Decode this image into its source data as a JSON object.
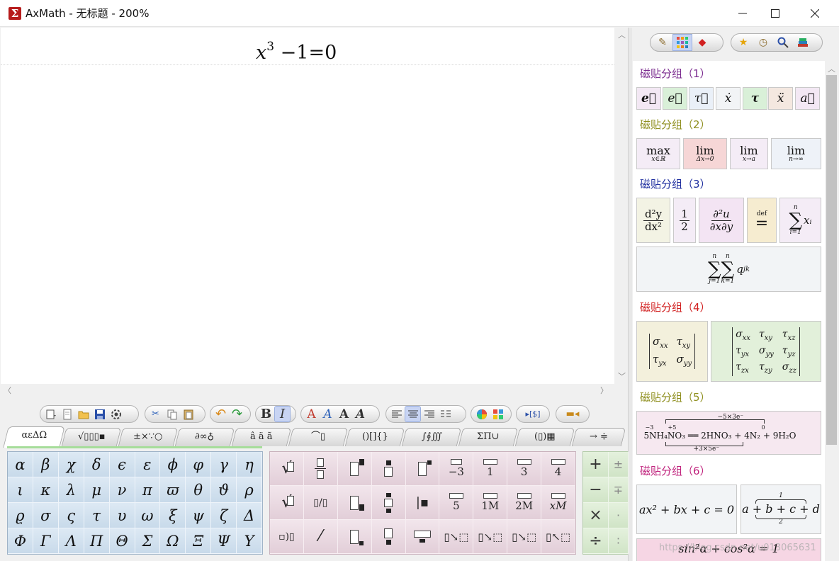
{
  "window": {
    "title": "AxMath - 无标题 - 200%",
    "logo_glyph": "Σ",
    "minimize": "minimize",
    "maximize": "maximize",
    "close": "close"
  },
  "editor": {
    "formula_base": "x",
    "formula_exp": "3",
    "formula_rest": "−1=0"
  },
  "toolbar": {
    "bold": "B",
    "italic": "I",
    "font_styles": [
      "A",
      "A",
      "A",
      "A"
    ]
  },
  "tabs": [
    "αεΔΩ",
    "√▯▯▯▪",
    "±×∵○",
    "∂∞♁",
    "â ä ã",
    "⌒▯",
    "()[]{}",
    "∫∮∭",
    "ΣΠ∪",
    "(▯)▦",
    "→ ≑"
  ],
  "greek": [
    "α",
    "β",
    "χ",
    "δ",
    "ϵ",
    "ε",
    "ϕ",
    "φ",
    "γ",
    "η",
    "ι",
    "κ",
    "λ",
    "μ",
    "ν",
    "π",
    "ϖ",
    "θ",
    "ϑ",
    "ρ",
    "ϱ",
    "σ",
    "ς",
    "τ",
    "υ",
    "ω",
    "ξ",
    "ψ",
    "ζ",
    "Δ",
    "Φ",
    "Γ",
    "Λ",
    "Π",
    "Θ",
    "Σ",
    "Ω",
    "Ξ",
    "Ψ",
    "Υ"
  ],
  "templates": {
    "labels": [
      "−3",
      "1",
      "3",
      "4",
      "5",
      "1M",
      "2M",
      "xM"
    ],
    "sqrt": "√",
    "nthroot": "√"
  },
  "operators": [
    "+",
    "−",
    "×",
    "÷"
  ],
  "panel": {
    "groups": [
      "磁贴分组（1）",
      "磁贴分组（2）",
      "磁贴分组（3）",
      "磁贴分组（4）",
      "磁贴分组（5）",
      "磁贴分组（6）"
    ],
    "group_colors": [
      "#7b2b8f",
      "#8f8f1f",
      "#1f2f9f",
      "#d12020",
      "#8f8f1f",
      "#c0237d"
    ],
    "vectors": [
      "e⃗",
      "e⃗",
      "τ⃗",
      "ẋ",
      "τ",
      "ẍ",
      "a⃗"
    ],
    "limits": [
      {
        "top": "max",
        "bot": "x∈ℝ"
      },
      {
        "top": "lim",
        "bot": "Δx→0"
      },
      {
        "top": "lim",
        "bot": "x→a"
      },
      {
        "top": "lim",
        "bot": "n→∞"
      }
    ],
    "g3": {
      "d2_num": "d²y",
      "d2_den": "dx²",
      "half_num": "1",
      "half_den": "2",
      "pd_num": "∂²u",
      "pd_den": "∂x∂y",
      "def_top": "def",
      "def_sym": "=",
      "sum": "∑",
      "sum_top": "n",
      "sum_bot": "i=1",
      "sum_body": "xᵢ",
      "dsum_top1": "n",
      "dsum_bot1": "j=1",
      "dsum_top2": "n",
      "dsum_bot2": "k=1",
      "dsum_body": "q",
      "dsum_sub": "jk"
    },
    "matrix2": [
      "σxx",
      "τxy",
      "τyx",
      "σyy"
    ],
    "matrix3": [
      "σxx",
      "τxy",
      "τxz",
      "τyx",
      "σyy",
      "τyz",
      "τzx",
      "τzy",
      "σzz"
    ],
    "reaction": {
      "top": "−5×3e⁻",
      "bottom": "+3×5e⁻",
      "left_top": "−3",
      "left_top2": "+5",
      "right_top": "0",
      "eq": "5NH₄NO₃ ══ 2HNO₃ + 4N₂ + 9H₂O"
    },
    "quadratic": "ax² + bx + c = 0",
    "brace_top": "1",
    "brace_bot": "2",
    "brace_expr": "a + b + c + d",
    "trig": "sin²α + cos²α = 1"
  },
  "watermark": "https://blog.csdn.net/u013065631"
}
